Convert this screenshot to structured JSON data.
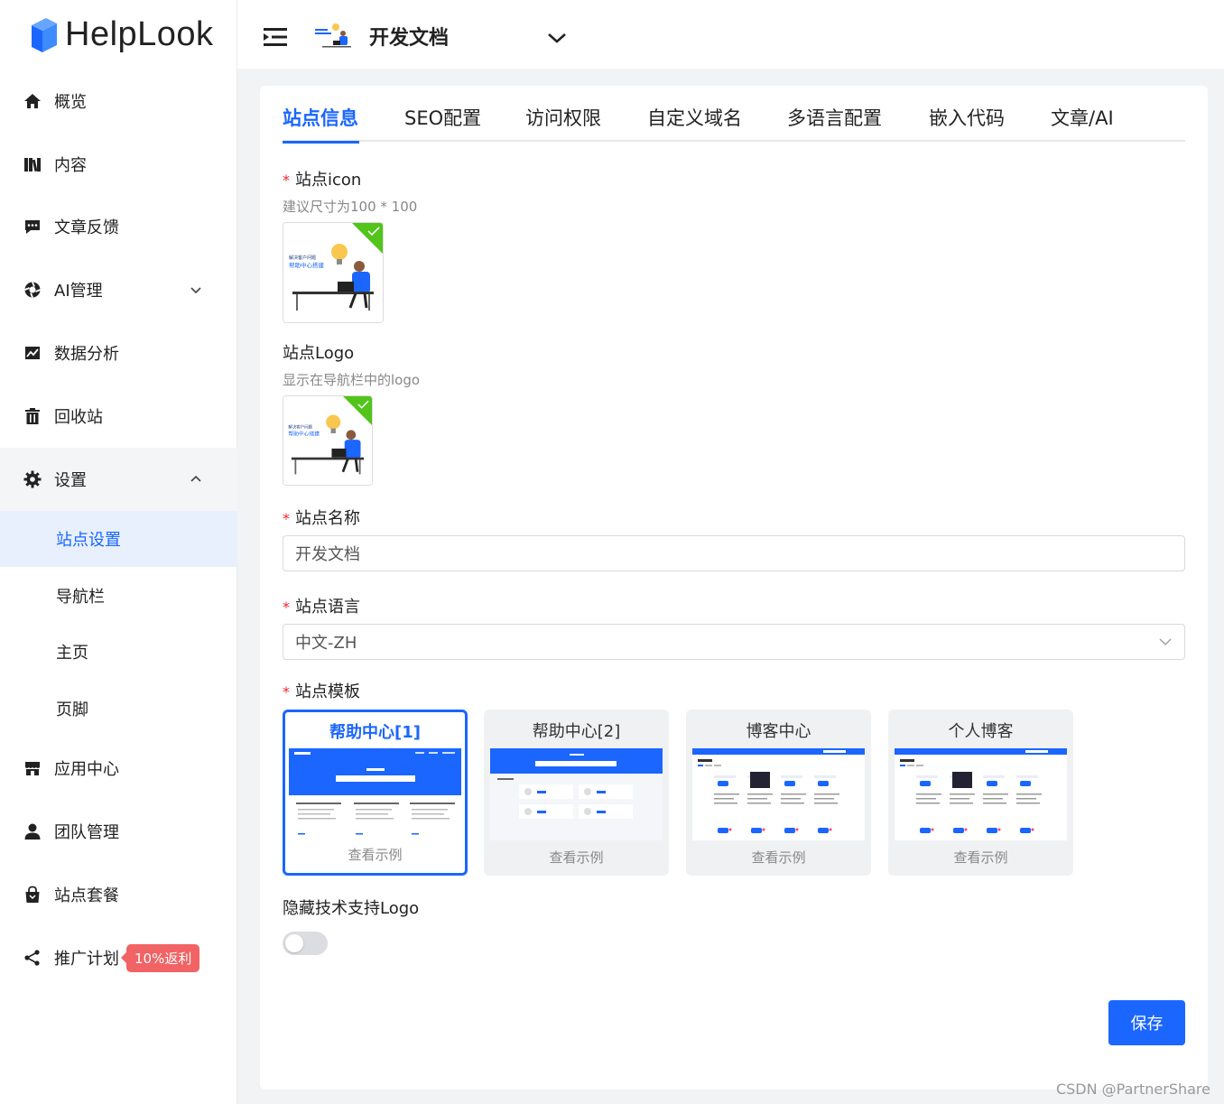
{
  "brand": {
    "name": "HelpLook",
    "accent": "#1a66ff"
  },
  "sidebar": {
    "items": [
      {
        "label": "概览",
        "icon": "home-icon"
      },
      {
        "label": "内容",
        "icon": "books-icon"
      },
      {
        "label": "文章反馈",
        "icon": "comment-icon"
      },
      {
        "label": "AI管理",
        "icon": "ai-icon",
        "expandable": true
      },
      {
        "label": "数据分析",
        "icon": "chart-icon"
      },
      {
        "label": "回收站",
        "icon": "trash-icon"
      },
      {
        "label": "设置",
        "icon": "gear-icon",
        "expanded": true
      },
      {
        "label": "应用中心",
        "icon": "store-icon"
      },
      {
        "label": "团队管理",
        "icon": "user-icon"
      },
      {
        "label": "站点套餐",
        "icon": "bag-icon"
      },
      {
        "label": "推广计划",
        "icon": "share-icon",
        "badge": "10%返利"
      }
    ],
    "settings_sub": [
      {
        "label": "站点设置",
        "active": true
      },
      {
        "label": "导航栏"
      },
      {
        "label": "主页"
      },
      {
        "label": "页脚"
      }
    ]
  },
  "header": {
    "site_title": "开发文档"
  },
  "tabs": [
    "站点信息",
    "SEO配置",
    "访问权限",
    "自定义域名",
    "多语言配置",
    "嵌入代码",
    "文章/AI"
  ],
  "form": {
    "icon_label": "站点icon",
    "icon_hint": "建议尺寸为100 * 100",
    "logo_label": "站点Logo",
    "logo_hint": "显示在导航栏中的logo",
    "name_label": "站点名称",
    "name_value": "开发文档",
    "lang_label": "站点语言",
    "lang_value": "中文-ZH",
    "template_label": "站点模板",
    "templates": [
      {
        "title": "帮助中心[1]",
        "link": "查看示例",
        "selected": true
      },
      {
        "title": "帮助中心[2]",
        "link": "查看示例"
      },
      {
        "title": "博客中心",
        "link": "查看示例"
      },
      {
        "title": "个人博客",
        "link": "查看示例"
      }
    ],
    "hide_logo_label": "隐藏技术支持Logo",
    "hide_logo_on": false,
    "save_label": "保存",
    "thumb_line1": "解决客户问题",
    "thumb_line2": "帮助中心搭建"
  },
  "watermark": "CSDN @PartnerShare"
}
